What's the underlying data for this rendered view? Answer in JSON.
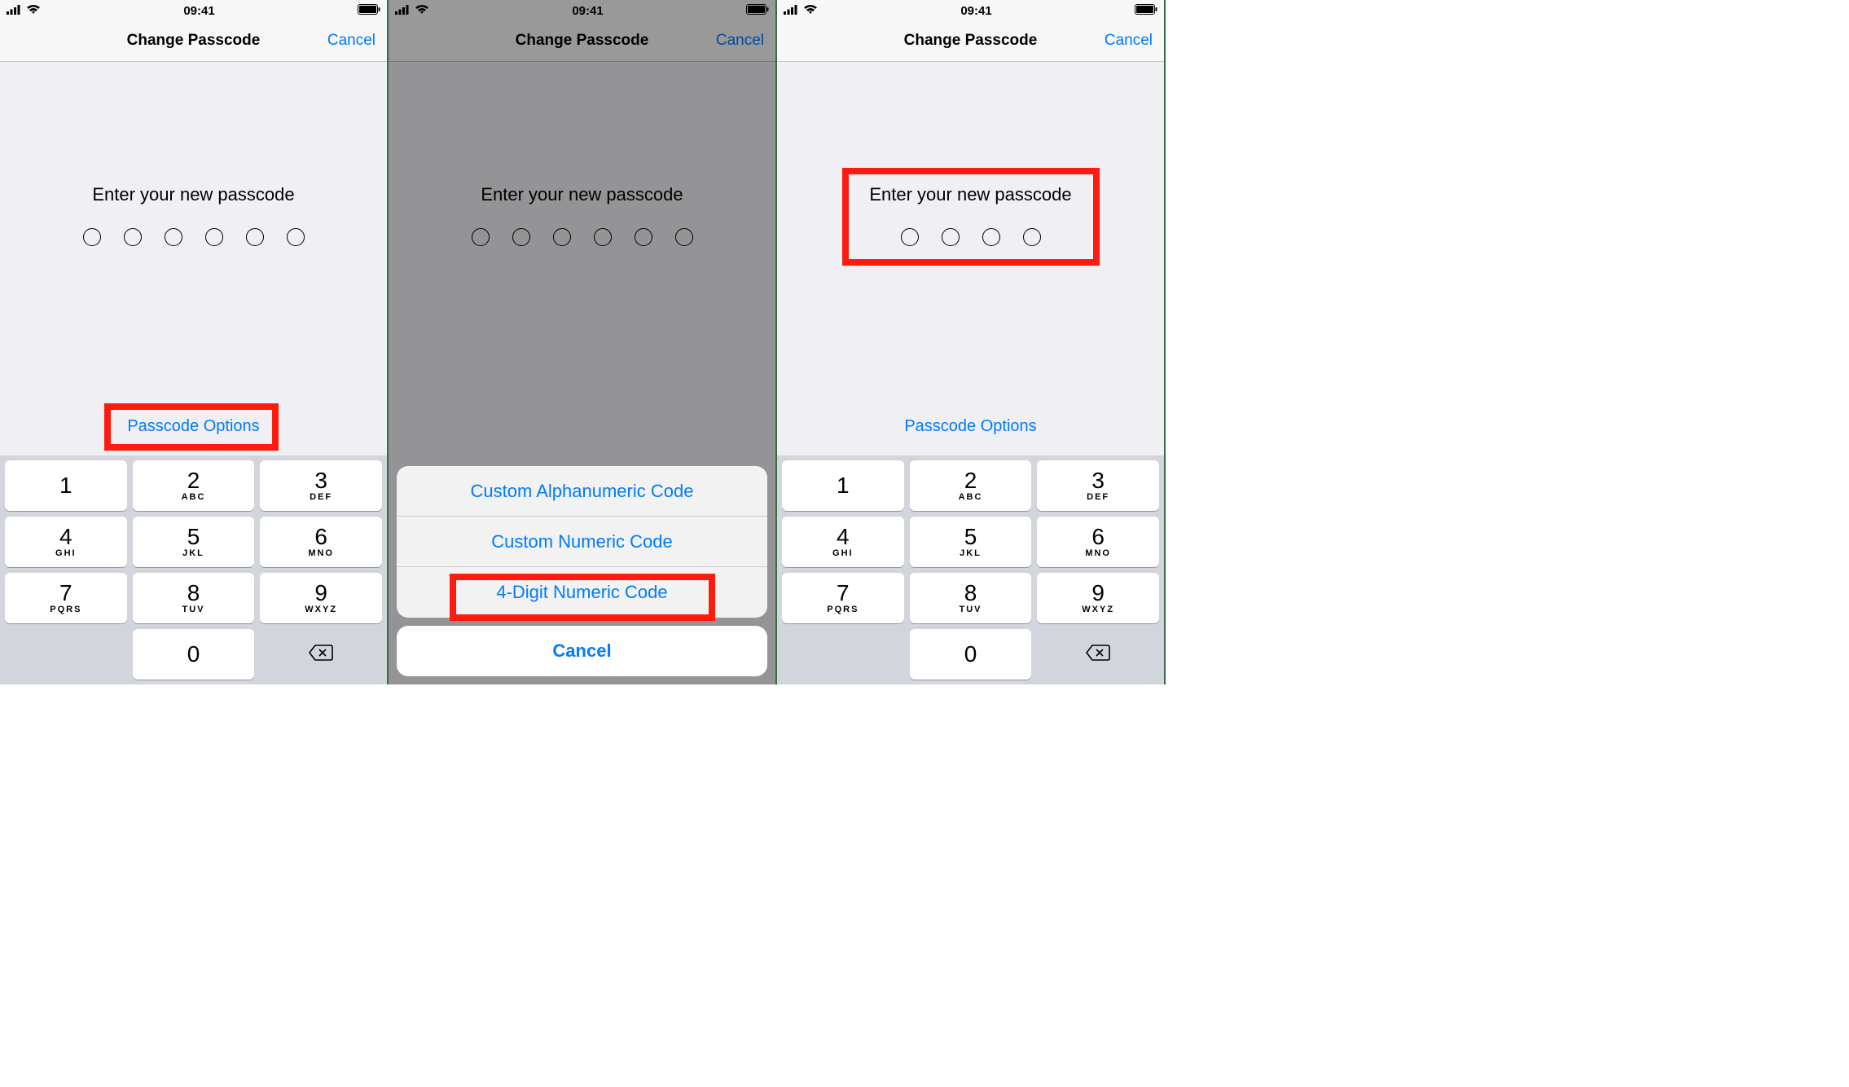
{
  "status": {
    "time": "09:41"
  },
  "nav": {
    "title": "Change Passcode",
    "cancel": "Cancel"
  },
  "prompt": "Enter your new passcode",
  "passcode_options": "Passcode Options",
  "sheet": {
    "items": [
      "Custom Alphanumeric Code",
      "Custom Numeric Code",
      "4-Digit Numeric Code"
    ],
    "cancel": "Cancel"
  },
  "keypad": [
    {
      "num": "1",
      "letters": ""
    },
    {
      "num": "2",
      "letters": "ABC"
    },
    {
      "num": "3",
      "letters": "DEF"
    },
    {
      "num": "4",
      "letters": "GHI"
    },
    {
      "num": "5",
      "letters": "JKL"
    },
    {
      "num": "6",
      "letters": "MNO"
    },
    {
      "num": "7",
      "letters": "PQRS"
    },
    {
      "num": "8",
      "letters": "TUV"
    },
    {
      "num": "9",
      "letters": "WXYZ"
    },
    {
      "num": "",
      "letters": ""
    },
    {
      "num": "0",
      "letters": ""
    }
  ]
}
